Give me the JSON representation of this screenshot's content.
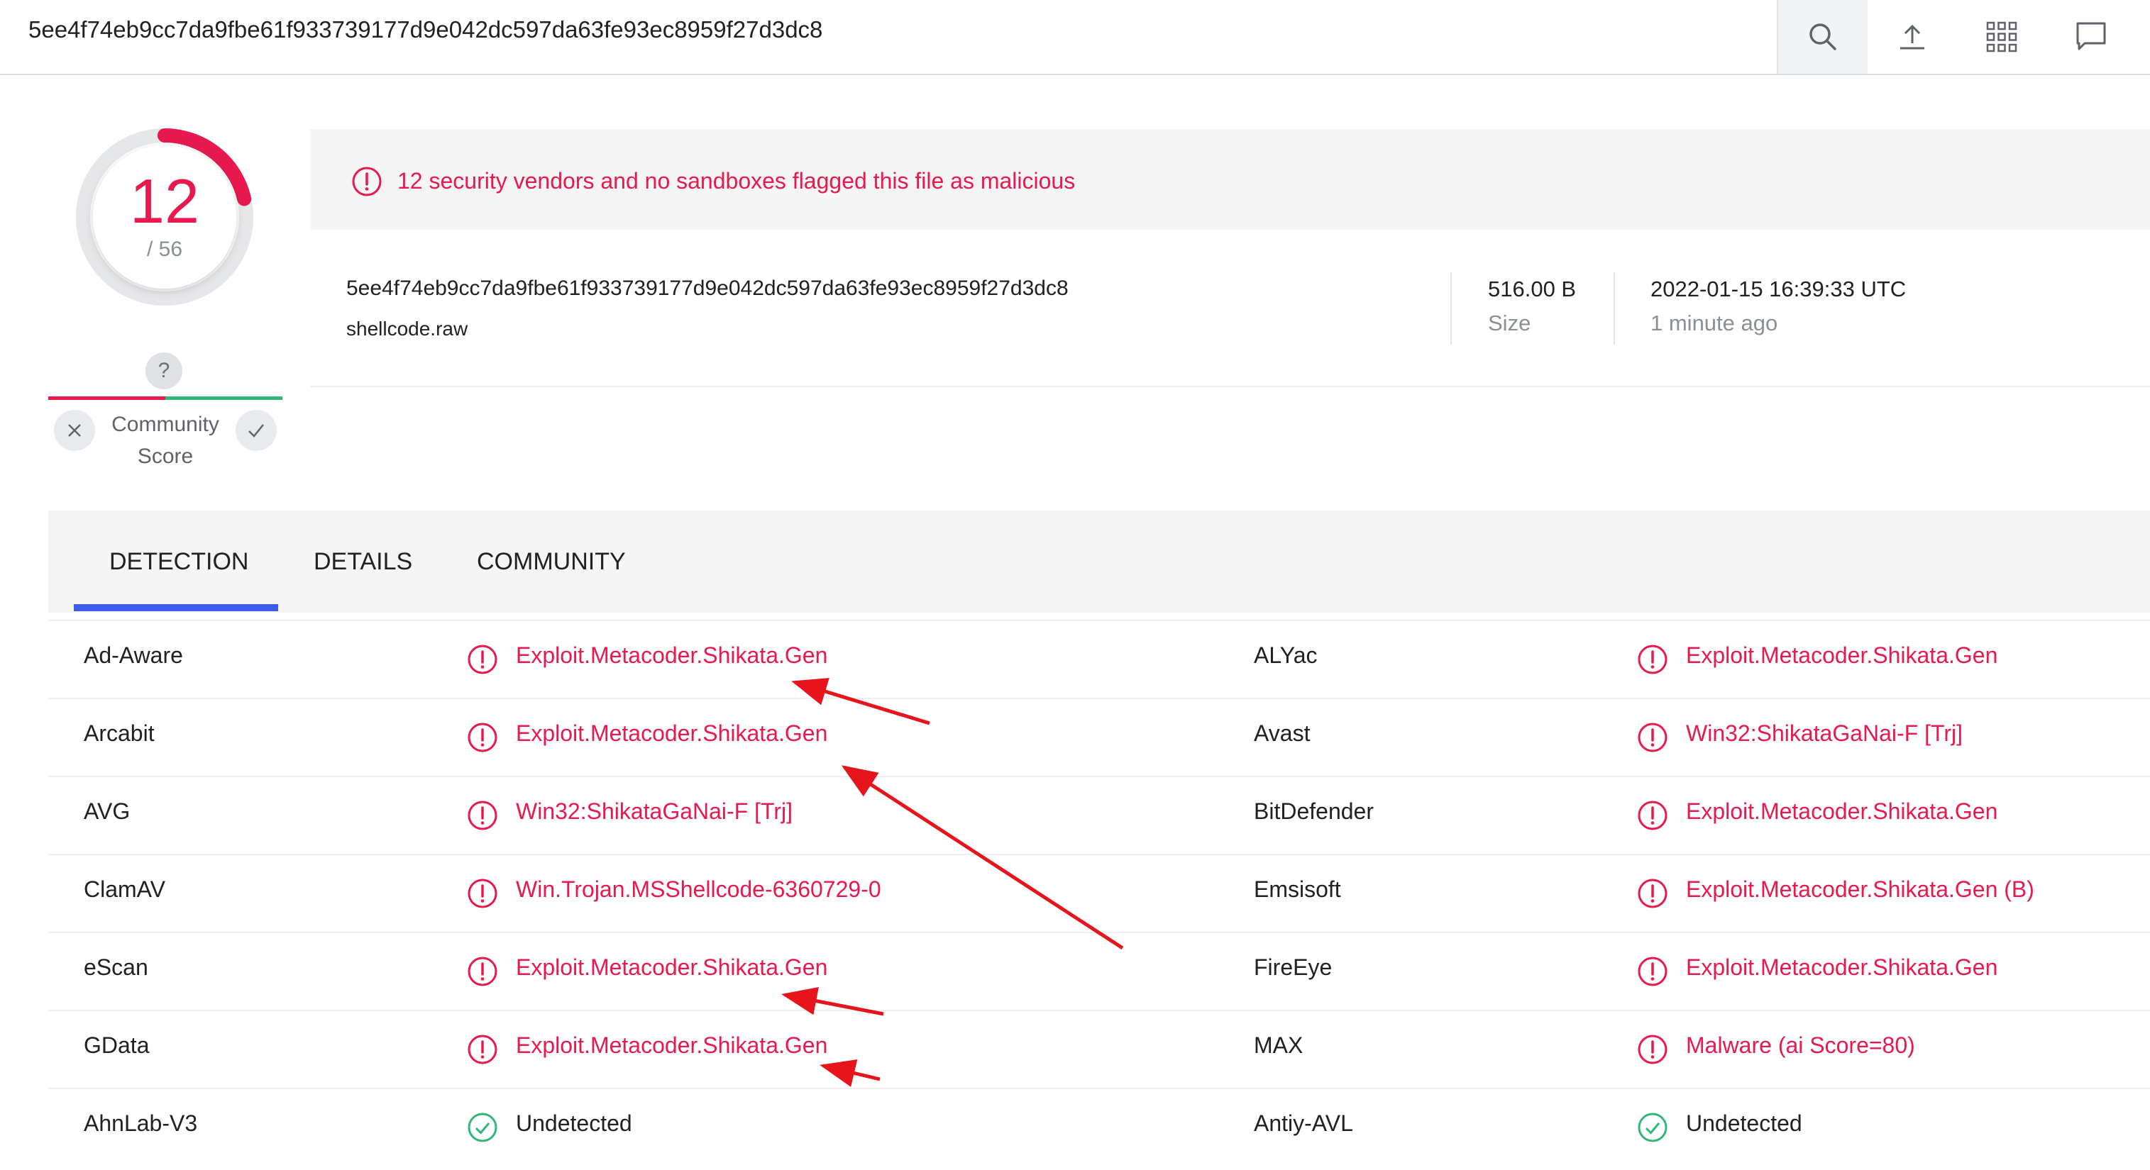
{
  "search": {
    "value": "5ee4f74eb9cc7da9fbe61f933739177d9e042dc597da63fe93ec8959f27d3dc8"
  },
  "toolbar": {
    "icons": [
      "search-icon",
      "upload-icon",
      "apps-grid-icon",
      "chat-icon"
    ]
  },
  "score": {
    "detections": "12",
    "total": "/ 56",
    "ratio": 0.2143
  },
  "community": {
    "question": "?",
    "label": "Community\nScore"
  },
  "summary": {
    "alert": "12 security vendors and no sandboxes flagged this file as malicious",
    "hash": "5ee4f74eb9cc7da9fbe61f933739177d9e042dc597da63fe93ec8959f27d3dc8",
    "filename": "shellcode.raw",
    "size_value": "516.00 B",
    "size_label": "Size",
    "date_value": "2022-01-15 16:39:33 UTC",
    "date_label": "1 minute ago"
  },
  "tabs": [
    {
      "label": "DETECTION",
      "active": true
    },
    {
      "label": "DETAILS",
      "active": false
    },
    {
      "label": "COMMUNITY",
      "active": false
    }
  ],
  "detections": [
    {
      "left_vendor": "Ad-Aware",
      "left_result": "Exploit.Metacoder.Shikata.Gen",
      "left_status": "malicious",
      "right_vendor": "ALYac",
      "right_result": "Exploit.Metacoder.Shikata.Gen",
      "right_status": "malicious"
    },
    {
      "left_vendor": "Arcabit",
      "left_result": "Exploit.Metacoder.Shikata.Gen",
      "left_status": "malicious",
      "right_vendor": "Avast",
      "right_result": "Win32:ShikataGaNai-F [Trj]",
      "right_status": "malicious"
    },
    {
      "left_vendor": "AVG",
      "left_result": "Win32:ShikataGaNai-F [Trj]",
      "left_status": "malicious",
      "right_vendor": "BitDefender",
      "right_result": "Exploit.Metacoder.Shikata.Gen",
      "right_status": "malicious"
    },
    {
      "left_vendor": "ClamAV",
      "left_result": "Win.Trojan.MSShellcode-6360729-0",
      "left_status": "malicious",
      "right_vendor": "Emsisoft",
      "right_result": "Exploit.Metacoder.Shikata.Gen (B)",
      "right_status": "malicious"
    },
    {
      "left_vendor": "eScan",
      "left_result": "Exploit.Metacoder.Shikata.Gen",
      "left_status": "malicious",
      "right_vendor": "FireEye",
      "right_result": "Exploit.Metacoder.Shikata.Gen",
      "right_status": "malicious"
    },
    {
      "left_vendor": "GData",
      "left_result": "Exploit.Metacoder.Shikata.Gen",
      "left_status": "malicious",
      "right_vendor": "MAX",
      "right_result": "Malware (ai Score=80)",
      "right_status": "malicious"
    },
    {
      "left_vendor": "AhnLab-V3",
      "left_result": "Undetected",
      "left_status": "undetected",
      "right_vendor": "Antiy-AVL",
      "right_result": "Undetected",
      "right_status": "undetected"
    }
  ],
  "colors": {
    "malicious": "#e7194e",
    "undetected": "#33b679",
    "accent": "#3b5be8",
    "annotation": "#e8141c"
  }
}
